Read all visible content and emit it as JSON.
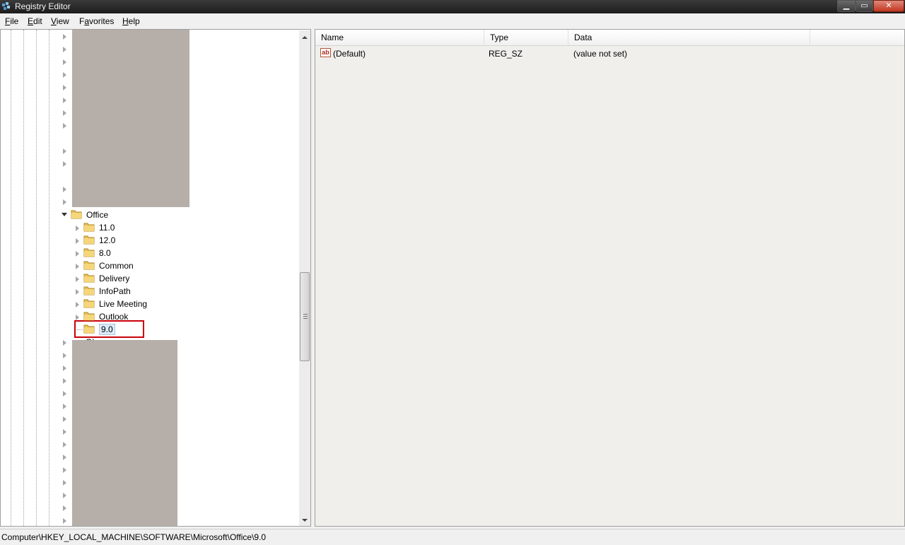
{
  "window": {
    "title": "Registry Editor",
    "minimize_glyph": "▁",
    "maximize_glyph": "▭",
    "close_glyph": "✕"
  },
  "menu": {
    "file": {
      "u": "F",
      "rest": "ile"
    },
    "edit": {
      "u": "E",
      "rest": "dit"
    },
    "view": {
      "u": "V",
      "rest": "iew"
    },
    "favorites": {
      "pre": "F",
      "u": "a",
      "rest": "vorites"
    },
    "help": {
      "u": "H",
      "rest": "elp"
    }
  },
  "tree": {
    "office_label": "Office",
    "children": [
      {
        "label": "11.0"
      },
      {
        "label": "12.0"
      },
      {
        "label": "8.0"
      },
      {
        "label": "Common"
      },
      {
        "label": "Delivery"
      },
      {
        "label": "InfoPath"
      },
      {
        "label": "Live Meeting"
      },
      {
        "label": "Outlook"
      },
      {
        "label": "9.0"
      }
    ],
    "partial_label": "Ol"
  },
  "list": {
    "columns": {
      "name": "Name",
      "type": "Type",
      "data": "Data"
    },
    "rows": [
      {
        "icon": "reg-sz-icon",
        "icon_text": "ab",
        "name": "(Default)",
        "type": "REG_SZ",
        "data": "(value not set)"
      }
    ]
  },
  "status": {
    "path": "Computer\\HKEY_LOCAL_MACHINE\\SOFTWARE\\Microsoft\\Office\\9.0"
  },
  "colors": {
    "highlight_box": "#c8000a",
    "redaction": "#b5aea9",
    "selection": "#dbeafa"
  }
}
